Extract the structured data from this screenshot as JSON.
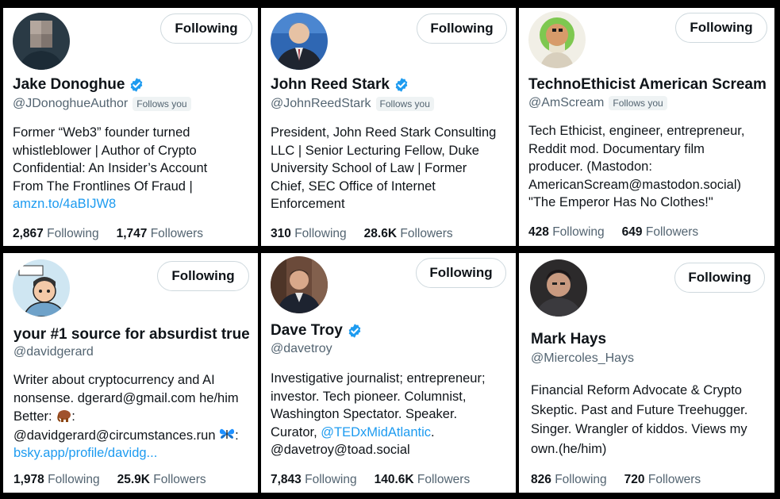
{
  "colors": {
    "link": "#1d9bf0",
    "verified": "#1d9bf0",
    "secondary_text": "#536471",
    "primary_text": "#0f1419"
  },
  "button_label": "Following",
  "follows_you_label": "Follows you",
  "following_label": "Following",
  "followers_label": "Followers",
  "cards": [
    {
      "name": "Jake Donoghue",
      "verified": true,
      "handle": "@JDonoghueAuthor",
      "follows_you": true,
      "bio": [
        "Former “Web3” founder turned",
        "whistleblower | Author of Crypto",
        "Confidential: An Insider’s Account",
        "From The Frontlines Of Fraud |"
      ],
      "bio_link": "amzn.to/4aBIJW8",
      "following_count": "2,867",
      "followers_count": "1,747"
    },
    {
      "name": "John Reed Stark",
      "verified": true,
      "handle": "@JohnReedStark",
      "follows_you": true,
      "bio": [
        "President, John Reed Stark Consulting",
        "LLC | Senior Lecturing Fellow, Duke",
        "University School of Law | Former",
        "Chief, SEC Office of Internet",
        "Enforcement"
      ],
      "following_count": "310",
      "followers_count": "28.6K"
    },
    {
      "name": "TechnoEthicist American Scream",
      "verified": false,
      "handle": "@AmScream",
      "follows_you": true,
      "bio": [
        "Tech Ethicist, engineer, entrepreneur,",
        "Reddit mod. Documentary film",
        "producer. (Mastodon:",
        "AmericanScream@mastodon.social)",
        "\"The Emperor Has No Clothes!\""
      ],
      "following_count": "428",
      "followers_count": "649"
    },
    {
      "name": "your #1 source for absurdist true",
      "verified": false,
      "handle": "@davidgerard",
      "follows_you": false,
      "bio": [
        "Writer about cryptocurrency and AI",
        "nonsense. dgerard@gmail.com he/him",
        "Better:",
        "@davidgerard@circumstances.run"
      ],
      "bio_link": "bsky.app/profile/davidg...",
      "following_count": "1,978",
      "followers_count": "25.9K"
    },
    {
      "name": "Dave Troy",
      "verified": true,
      "handle": "@davetroy",
      "follows_you": false,
      "bio": [
        "Investigative journalist; entrepreneur;",
        "investor. Tech pioneer. Columnist,",
        "Washington Spectator. Speaker.",
        "Curator,",
        "@davetroy@toad.social"
      ],
      "bio_mention": "@TEDxMidAtlantic",
      "following_count": "7,843",
      "followers_count": "140.6K"
    },
    {
      "name": "Mark Hays",
      "verified": false,
      "handle": "@Miercoles_Hays",
      "follows_you": false,
      "bio": [
        "Financial Reform Advocate & Crypto",
        "Skeptic. Past and Future Treehugger.",
        "Singer. Wrangler of kiddos. Views my",
        "own.(he/him)"
      ],
      "following_count": "826",
      "followers_count": "720"
    }
  ]
}
